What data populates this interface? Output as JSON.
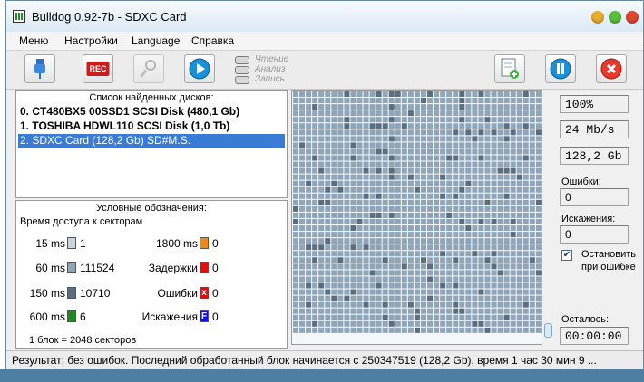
{
  "window": {
    "title": "Bulldog 0.92-7b - SDXC Card"
  },
  "menu": {
    "items": [
      "Меню",
      "Настройки",
      "Language",
      "Справка"
    ]
  },
  "toolbar": {
    "rec_label": "REC",
    "indicators": [
      "Чтение",
      "Анализ",
      "Запись"
    ]
  },
  "disks": {
    "header": "Список найденных дисков:",
    "items": [
      "0. CT480BX5 00SSD1 SCSI Disk  (480,1 Gb)",
      "1. TOSHIBA HDWL110 SCSI Disk  (1,0 Tb)",
      "2. SDXC Card (128,2 Gb) SD#M.S."
    ],
    "selected_index": 2
  },
  "legend": {
    "header": "Условные обозначения:",
    "subheader": "Время доступа к секторам",
    "left": [
      {
        "label": "15 ms",
        "count": "1",
        "color": "#c8d4de"
      },
      {
        "label": "60 ms",
        "count": "111524",
        "color": "#8fa6ba"
      },
      {
        "label": "150 ms",
        "count": "10710",
        "color": "#5a6e80"
      },
      {
        "label": "600 ms",
        "count": "6",
        "color": "#1e8a1e"
      }
    ],
    "right": [
      {
        "label": "1800 ms",
        "count": "0",
        "color": "#f08a14"
      },
      {
        "label": "Задержки",
        "count": "0",
        "color": "#e01010"
      },
      {
        "label": "Ошибки",
        "count": "0",
        "color": "#e01010",
        "glyph": "x"
      },
      {
        "label": "Искажения",
        "count": "0",
        "color": "#1010d8",
        "glyph": "F"
      }
    ],
    "footnote": "1 блок = 2048 секторов"
  },
  "stats": {
    "progress": "100%",
    "speed": "24 Mb/s",
    "size": "128,2 Gb",
    "errors_label": "Ошибки:",
    "errors_value": "0",
    "distortions_label": "Искажения:",
    "distortions_value": "0",
    "stop_label_1": "Остановить",
    "stop_label_2": "при ошибке",
    "stop_checked": true,
    "remaining_label": "Осталось:",
    "remaining_value": "00:00:00"
  },
  "status": {
    "text": "Результат: без ошибок. Последний обработанный блок начинается с 250347519 (128,2 Gb), время 1 час 30 мин 9 ..."
  },
  "colors": {
    "cell_light": "#8fa6ba",
    "cell_dark": "#5a6e80",
    "selection": "#3a7bd5"
  }
}
